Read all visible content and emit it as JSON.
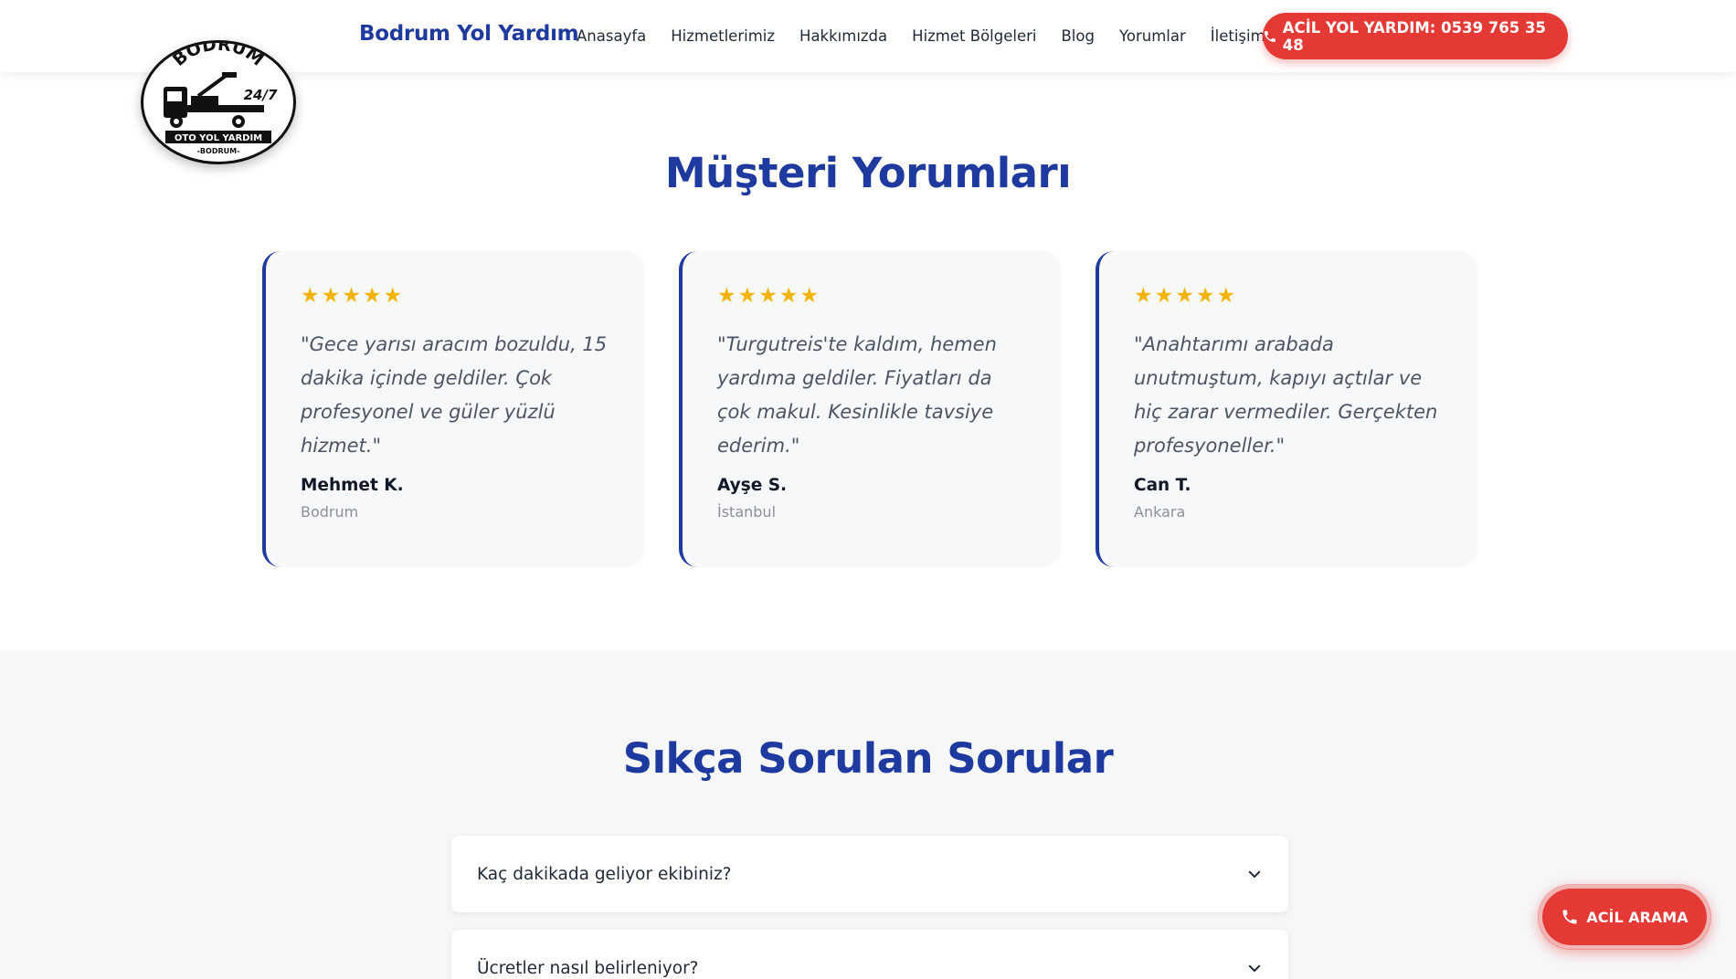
{
  "header": {
    "brand": "Bodrum Yol Yardım",
    "nav": [
      "Anasayfa",
      "Hizmetlerimiz",
      "Hakkımızda",
      "Hizmet Bölgeleri",
      "Blog",
      "Yorumlar",
      "İletişim"
    ],
    "cta_label": "ACİL YOL YARDIM: 0539 765 35 48",
    "cta_icon": "phone-icon"
  },
  "logo": {
    "top_text": "BODRUM",
    "badge_text": "24/7",
    "band_text": "OTO YOL YARDIM",
    "bottom_text": "-BODRUM-"
  },
  "testimonials": {
    "title": "Müşteri Yorumları",
    "rating_icon": "star-icon",
    "items": [
      {
        "rating": 5,
        "stars": "★★★★★",
        "quote": "\"Gece yarısı aracım bozuldu, 15 dakika içinde geldiler. Çok profesyonel ve güler yüzlü hizmet.\"",
        "name": "Mehmet K.",
        "city": "Bodrum"
      },
      {
        "rating": 5,
        "stars": "★★★★★",
        "quote": "\"Turgutreis'te kaldım, hemen yardıma geldiler. Fiyatları da çok makul. Kesinlikle tavsiye ederim.\"",
        "name": "Ayşe S.",
        "city": "İstanbul"
      },
      {
        "rating": 5,
        "stars": "★★★★★",
        "quote": "\"Anahtarımı arabada unutmuştum, kapıyı açtılar ve hiç zarar vermediler. Gerçekten profesyoneller.\"",
        "name": "Can T.",
        "city": "Ankara"
      }
    ]
  },
  "faq": {
    "title": "Sıkça Sorulan Sorular",
    "items": [
      {
        "question": "Kaç dakikada geliyor ekibiniz?"
      },
      {
        "question": "Ücretler nasıl belirleniyor?"
      }
    ],
    "toggle_icon": "chevron-down-icon"
  },
  "floating": {
    "label": "ACİL ARAMA",
    "icon": "phone-icon"
  },
  "colors": {
    "brand_blue": "#1e3a9e",
    "accent_red": "#e53935",
    "star_yellow": "#f5b301"
  }
}
